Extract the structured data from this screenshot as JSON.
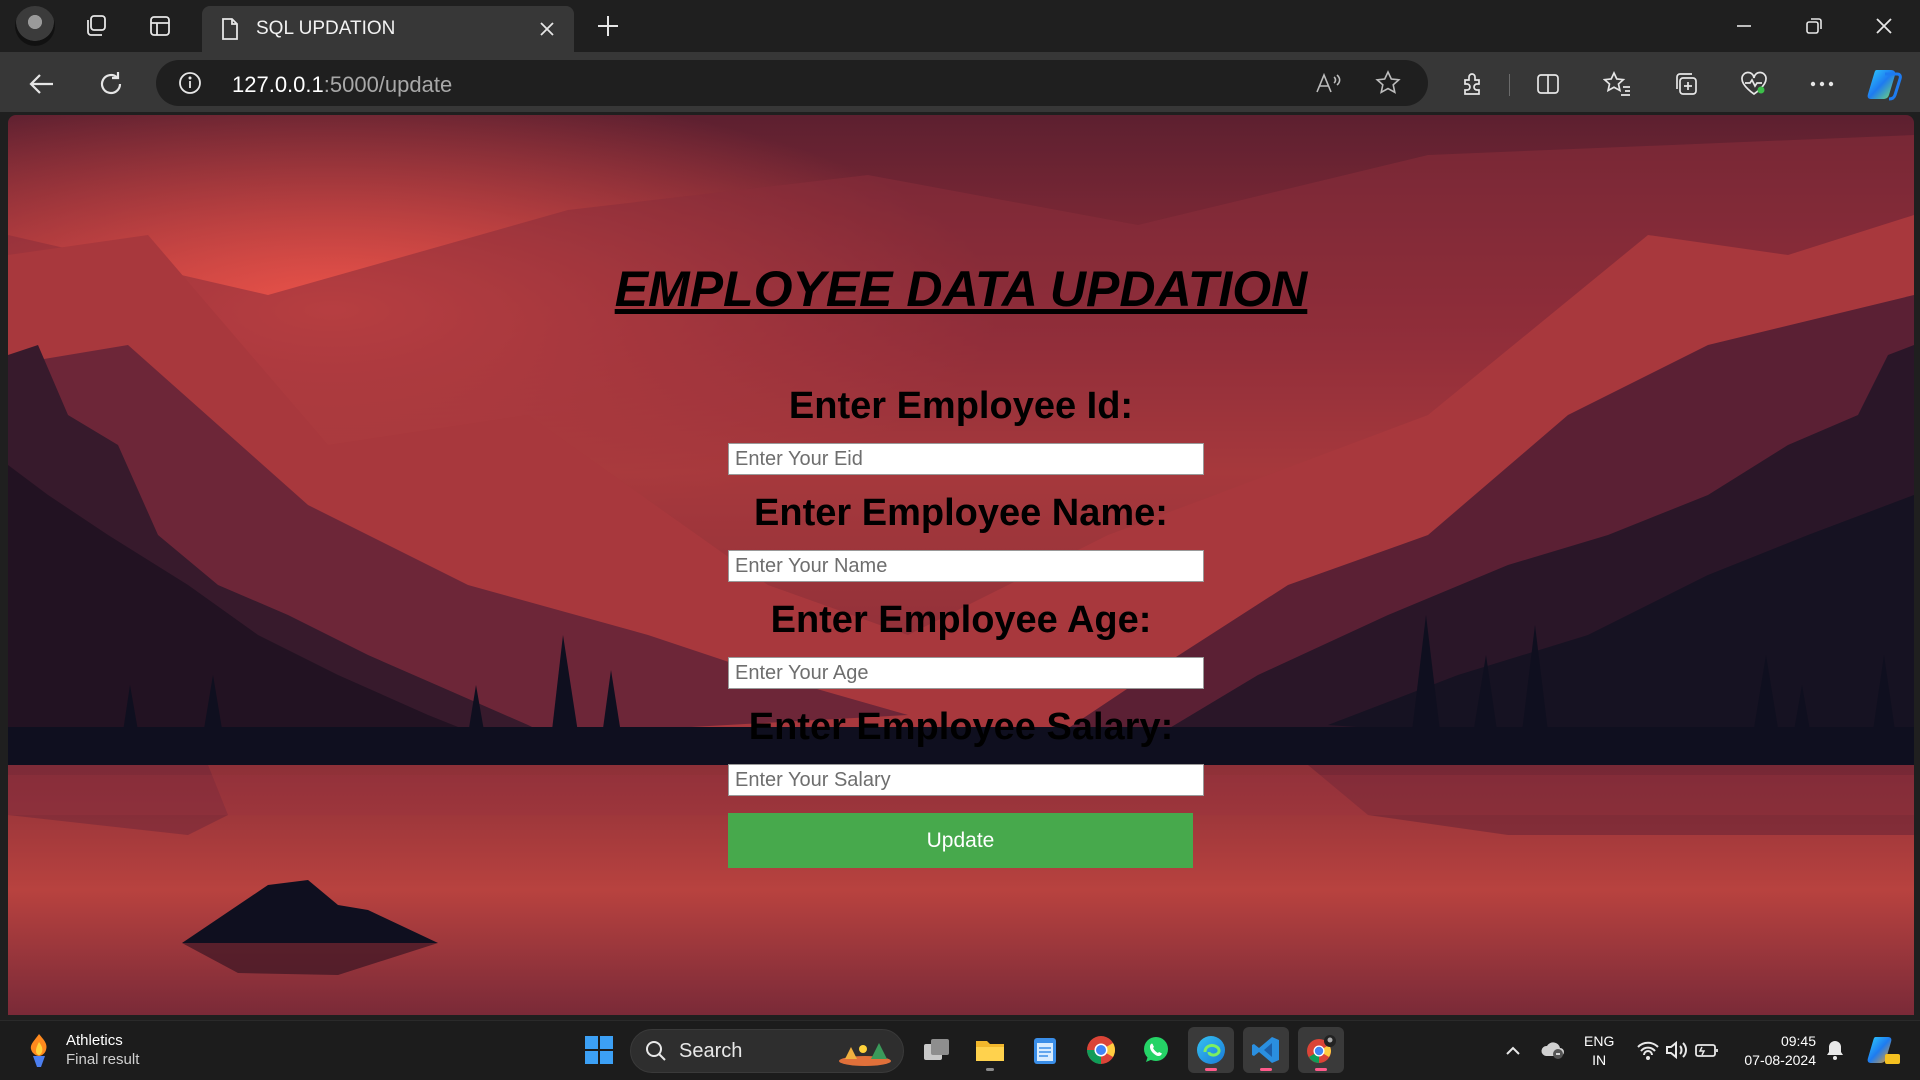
{
  "browser": {
    "tab_title": "SQL UPDATION",
    "url_host": "127.0.0.1",
    "url_path": ":5000/update"
  },
  "page": {
    "title": "EMPLOYEE DATA UPDATION",
    "fields": [
      {
        "label": "Enter Employee Id:",
        "placeholder": "Enter Your Eid",
        "value": ""
      },
      {
        "label": "Enter Employee Name:",
        "placeholder": "Enter Your Name",
        "value": ""
      },
      {
        "label": "Enter Employee Age:",
        "placeholder": "Enter Your Age",
        "value": ""
      },
      {
        "label": "Enter Employee Salary:",
        "placeholder": "Enter Your Salary",
        "value": ""
      }
    ],
    "submit_label": "Update"
  },
  "taskbar": {
    "weather_title": "Athletics",
    "weather_subtitle": "Final result",
    "search_label": "Search",
    "lang_line1": "ENG",
    "lang_line2": "IN",
    "time": "09:45",
    "date": "07-08-2024"
  },
  "colors": {
    "button": "#47a94c",
    "sky_glow": "#e9524a",
    "silhouette": "#0f0f1f",
    "chrome_dark": "#1f1f1f",
    "chrome_mid": "#373737"
  },
  "icons": [
    "profile-avatar",
    "workspaces-icon",
    "tab-actions-icon",
    "page-icon",
    "close-icon",
    "plus-icon",
    "minimize-icon",
    "restore-icon",
    "back-icon",
    "refresh-icon",
    "info-icon",
    "read-aloud-icon",
    "star-icon",
    "extensions-icon",
    "split-screen-icon",
    "favorites-icon",
    "collections-icon",
    "browser-essentials-icon",
    "more-icon",
    "copilot-icon",
    "windows-start-icon",
    "search-icon",
    "task-view-icon",
    "file-explorer-icon",
    "notepad-icon",
    "chrome-icon",
    "whatsapp-icon",
    "edge-icon",
    "vscode-icon",
    "wifi-icon",
    "volume-icon",
    "battery-icon",
    "bell-icon"
  ]
}
